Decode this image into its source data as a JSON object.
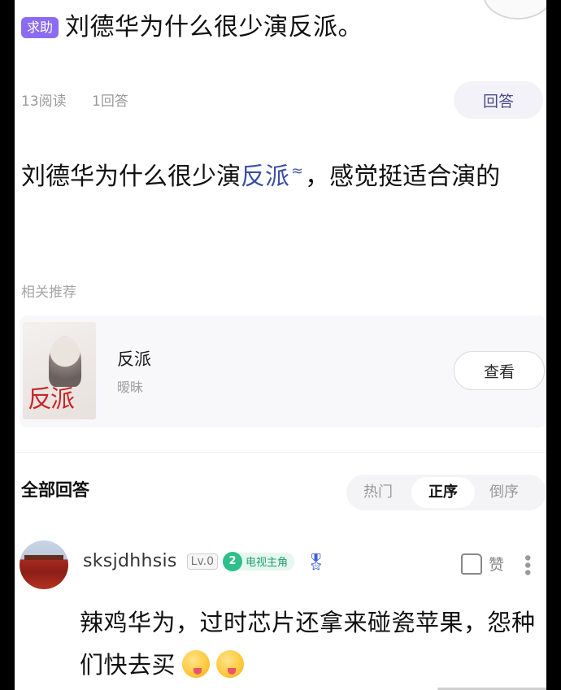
{
  "question": {
    "tag": "求助",
    "title": "刘德华为什么很少演反派。",
    "reads": "13阅读",
    "answers_count": "1回答",
    "answer_button": "回答",
    "body_prefix": "刘德华为什么很少演",
    "body_link": "反派",
    "body_suffix": "，感觉挺适合演的"
  },
  "related": {
    "label": "相关推荐",
    "item_title": "反派",
    "item_subtitle": "暧昧",
    "cover_title": "反派",
    "view_button": "查看"
  },
  "answers_section": {
    "title": "全部回答",
    "sort_tabs": [
      "热门",
      "正序",
      "倒序"
    ],
    "active_tab": "正序"
  },
  "answer": {
    "username": "sksjdhhsis",
    "level": "Lv.0",
    "badge_num": "2",
    "badge_text": "电视主角",
    "like_label": "赞",
    "text": "辣鸡华为，过时芯片还拿来碰瓷苹果，怨种们快去买"
  },
  "icons": [
    "link-icon",
    "medal-icon",
    "thumbs-up-icon",
    "more-icon",
    "emoji-icon"
  ]
}
